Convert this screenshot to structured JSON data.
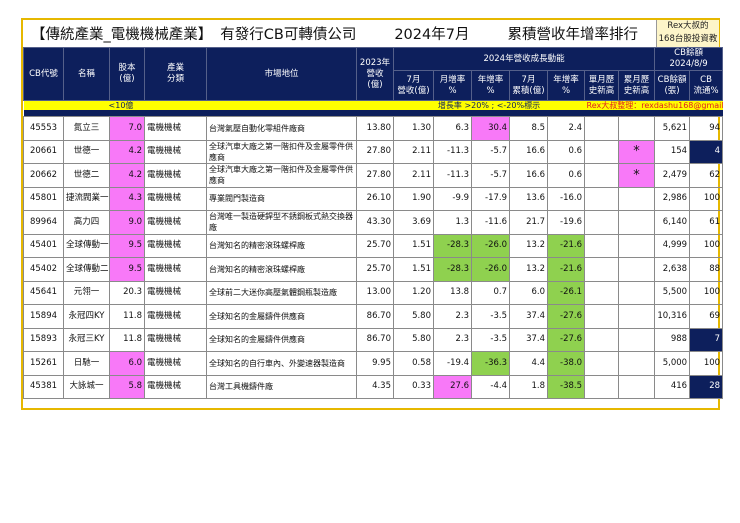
{
  "title": {
    "category": "【傳統產業_電機機械產業】",
    "subtitle": "有發行CB可轉債公司",
    "period": "2024年7月",
    "ranking": "累積營收年增率排行"
  },
  "rex_box": {
    "line1": "Rex大叔的",
    "line2": "168台股投資教室"
  },
  "headers": {
    "cb_code": "CB代號",
    "name": "名稱",
    "capital": "股本\n(億)",
    "industry": "產業\n分類",
    "market": "市場地位",
    "rev2023": "2023年\n營收(億)",
    "growth_group": "2024年營收成長動能",
    "cb_group": "CB餘額\n2024/8/9",
    "jul_rev": "7月\n營收(億)",
    "mom": "月增率\n%",
    "yoy": "年增率\n%",
    "cum": "7月\n累積(億)",
    "cum_yoy": "年增率\n%",
    "month_high": "單月歷\n史新高",
    "cum_high": "累月歷\n史新高",
    "cb_bal": "CB餘額\n(張)",
    "cb_float": "CB\n流通%"
  },
  "legend": {
    "capital_note": "<10億",
    "growth_note": "增長率 >20% ; <-20%標示",
    "credit": "Rex大叔整理：rexdashu168@gmail.com"
  },
  "colors": {
    "navy": "#0d1f5c",
    "pink": "#f879f8",
    "green": "#8fd14f",
    "yellow": "#ffff00"
  },
  "rows": [
    {
      "code": "45553",
      "name": "氮立三",
      "cap": "7.0",
      "ind": "電機機械",
      "mkt": "台灣氣壓自動化零組件廠商",
      "r23": "13.80",
      "jul": "1.30",
      "mom": "6.3",
      "yoy": "30.4",
      "cum": "8.5",
      "cyoy": "2.4",
      "mh": "",
      "ch": "",
      "bal": "5,621",
      "flt": "94",
      "hl": {
        "cap": "pink",
        "yoy": "pink"
      }
    },
    {
      "code": "20661",
      "name": "世德一",
      "cap": "4.2",
      "ind": "電機機械",
      "mkt": "全球汽車大廠之第一階扣件及金屬零件供應商",
      "r23": "27.80",
      "jul": "2.11",
      "mom": "-11.3",
      "yoy": "-5.7",
      "cum": "16.6",
      "cyoy": "0.6",
      "mh": "",
      "ch": "*",
      "bal": "154",
      "flt": "4",
      "hl": {
        "cap": "pink",
        "ch": "pink",
        "flt": "navy"
      }
    },
    {
      "code": "20662",
      "name": "世德二",
      "cap": "4.2",
      "ind": "電機機械",
      "mkt": "全球汽車大廠之第一階扣件及金屬零件供應商",
      "r23": "27.80",
      "jul": "2.11",
      "mom": "-11.3",
      "yoy": "-5.7",
      "cum": "16.6",
      "cyoy": "0.6",
      "mh": "",
      "ch": "*",
      "bal": "2,479",
      "flt": "62",
      "hl": {
        "cap": "pink",
        "ch": "pink"
      }
    },
    {
      "code": "45801",
      "name": "捷流閥業一",
      "cap": "4.3",
      "ind": "電機機械",
      "mkt": "專業閥門製造商",
      "r23": "26.10",
      "jul": "1.90",
      "mom": "-9.9",
      "yoy": "-17.9",
      "cum": "13.6",
      "cyoy": "-16.0",
      "mh": "",
      "ch": "",
      "bal": "2,986",
      "flt": "100",
      "hl": {
        "cap": "pink"
      }
    },
    {
      "code": "89964",
      "name": "高力四",
      "cap": "9.0",
      "ind": "電機機械",
      "mkt": "台灣唯一製造硬銲型不銹鋼板式熱交換器廠",
      "r23": "43.30",
      "jul": "3.69",
      "mom": "1.3",
      "yoy": "-11.6",
      "cum": "21.7",
      "cyoy": "-19.6",
      "mh": "",
      "ch": "",
      "bal": "6,140",
      "flt": "61",
      "hl": {
        "cap": "pink"
      }
    },
    {
      "code": "45401",
      "name": "全球傳動一",
      "cap": "9.5",
      "ind": "電機機械",
      "mkt": "台灣知名的精密滾珠螺桿廠",
      "r23": "25.70",
      "jul": "1.51",
      "mom": "-28.3",
      "yoy": "-26.0",
      "cum": "13.2",
      "cyoy": "-21.6",
      "mh": "",
      "ch": "",
      "bal": "4,999",
      "flt": "100",
      "hl": {
        "cap": "pink",
        "mom": "green",
        "yoy": "green",
        "cyoy": "green"
      }
    },
    {
      "code": "45402",
      "name": "全球傳動二",
      "cap": "9.5",
      "ind": "電機機械",
      "mkt": "台灣知名的精密滾珠螺桿廠",
      "r23": "25.70",
      "jul": "1.51",
      "mom": "-28.3",
      "yoy": "-26.0",
      "cum": "13.2",
      "cyoy": "-21.6",
      "mh": "",
      "ch": "",
      "bal": "2,638",
      "flt": "88",
      "hl": {
        "cap": "pink",
        "mom": "green",
        "yoy": "green",
        "cyoy": "green"
      }
    },
    {
      "code": "45641",
      "name": "元翎一",
      "cap": "20.3",
      "ind": "電機機械",
      "mkt": "全球前二大迷你高壓氣體鋼瓶製造廠",
      "r23": "13.00",
      "jul": "1.20",
      "mom": "13.8",
      "yoy": "0.7",
      "cum": "6.0",
      "cyoy": "-26.1",
      "mh": "",
      "ch": "",
      "bal": "5,500",
      "flt": "100",
      "hl": {
        "cyoy": "green"
      }
    },
    {
      "code": "15894",
      "name": "永冠四KY",
      "cap": "11.8",
      "ind": "電機機械",
      "mkt": "全球知名的金屬鑄件供應商",
      "r23": "86.70",
      "jul": "5.80",
      "mom": "2.3",
      "yoy": "-3.5",
      "cum": "37.4",
      "cyoy": "-27.6",
      "mh": "",
      "ch": "",
      "bal": "10,316",
      "flt": "69",
      "hl": {
        "cyoy": "green"
      }
    },
    {
      "code": "15893",
      "name": "永冠三KY",
      "cap": "11.8",
      "ind": "電機機械",
      "mkt": "全球知名的金屬鑄件供應商",
      "r23": "86.70",
      "jul": "5.80",
      "mom": "2.3",
      "yoy": "-3.5",
      "cum": "37.4",
      "cyoy": "-27.6",
      "mh": "",
      "ch": "",
      "bal": "988",
      "flt": "7",
      "hl": {
        "cyoy": "green",
        "flt": "navy"
      }
    },
    {
      "code": "15261",
      "name": "日馳一",
      "cap": "6.0",
      "ind": "電機機械",
      "mkt": "全球知名的自行車內、外變速器製造商",
      "r23": "9.95",
      "jul": "0.58",
      "mom": "-19.4",
      "yoy": "-36.3",
      "cum": "4.4",
      "cyoy": "-38.0",
      "mh": "",
      "ch": "",
      "bal": "5,000",
      "flt": "100",
      "hl": {
        "cap": "pink",
        "yoy": "green",
        "cyoy": "green"
      }
    },
    {
      "code": "45381",
      "name": "大詠城一",
      "cap": "5.8",
      "ind": "電機機械",
      "mkt": "台灣工具機鑄件廠",
      "r23": "4.35",
      "jul": "0.33",
      "mom": "27.6",
      "yoy": "-4.4",
      "cum": "1.8",
      "cyoy": "-38.5",
      "mh": "",
      "ch": "",
      "bal": "416",
      "flt": "28",
      "hl": {
        "cap": "pink",
        "mom": "pink",
        "cyoy": "green",
        "flt": "navy"
      }
    }
  ]
}
